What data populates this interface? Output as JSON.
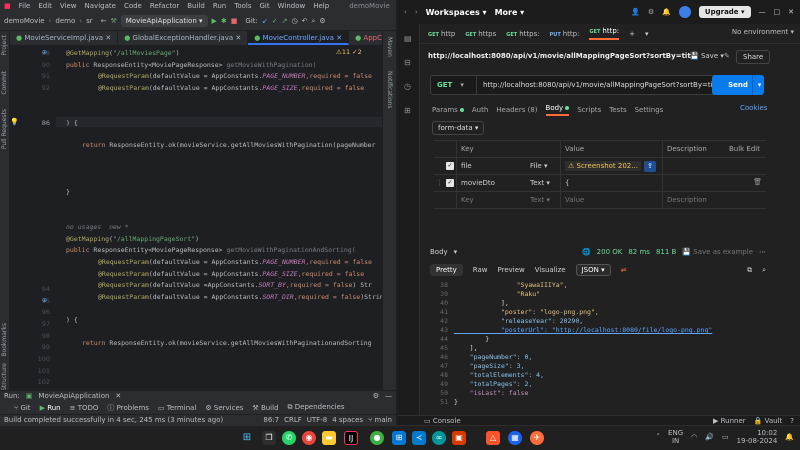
{
  "ide": {
    "menu": [
      "File",
      "Edit",
      "View",
      "Navigate",
      "Code",
      "Refactor",
      "Build",
      "Run",
      "Tools",
      "Git",
      "Window",
      "Help"
    ],
    "project_title": "demoMovie",
    "breadcrumb": [
      "demoMovie",
      "demo",
      "sr"
    ],
    "run_config": "MovieApiApplication",
    "git_label": "Git:",
    "tabs": [
      "MovieServiceImpl.java",
      "GlobalExceptionHandler.java",
      "MovieController.java",
      "AppConstants.java"
    ],
    "left_strip": [
      "Project",
      "Commit",
      "Pull Requests",
      "Bookmarks",
      "Structure"
    ],
    "right_strip": [
      "Maven",
      "Notifications"
    ],
    "inspection": "⚠11 ✓2",
    "hints": {
      "no_usages": "no usages",
      "new": "new *"
    },
    "code": {
      "l89_annotation": "@GetMapping",
      "l89_arg": "\"/allMoviesPage\"",
      "public": "public",
      "resp_entity_type": "ResponseEntity<MoviePageResponse>",
      "m1": "getMovieWithPagination(",
      "req_param": "@RequestParam",
      "default_value": "(defaultValue = ",
      "app_constants": "AppConstants.",
      "page_number": "PAGE_NUMBER",
      "page_size": "PAGE_SIZE",
      "sort_by": "SORT_BY",
      "sort_dir": "SORT_DIR",
      "required_false": ",required = false",
      "brace_open": ") {",
      "return": "return",
      "ret1": "ResponseEntity.ok(movieService.getAllMoviesWithPagination(pageNumber",
      "brace_close": "}",
      "l95_arg": "\"/allMappingPageSort\"",
      "m2": "getMovieWithPaginationAndSorting(",
      "sort_by_prefix": "(defaultValue =AppConstants.",
      "tail_str": ") Str",
      "tail_string": ")String",
      "ret2": "ResponseEntity.ok(movieService.getAllMoviesWithPaginationandSorting"
    },
    "line_numbers": [
      89,
      90,
      91,
      92,
      "",
      86,
      "",
      "",
      "",
      "",
      "",
      "",
      "",
      "",
      "",
      94,
      95,
      96,
      97,
      98,
      99,
      100,
      101,
      102,
      103,
      104
    ],
    "run_tab": "MovieApiApplication",
    "run_label": "Run:",
    "tool_windows": [
      "Git",
      "Run",
      "TODO",
      "Problems",
      "Terminal",
      "Services",
      "Build",
      "Dependencies"
    ],
    "status": {
      "message": "Build completed successfully in 4 sec, 245 ms (3 minutes ago)",
      "pos": "86:7",
      "crlf": "CRLF",
      "enc": "UTF-8",
      "indent": "4 spaces",
      "branch": "main"
    }
  },
  "postman": {
    "workspaces": "Workspaces",
    "more": "More",
    "upgrade": "Upgrade",
    "tabs": [
      {
        "method": "GET",
        "label": "http"
      },
      {
        "method": "GET",
        "label": "https"
      },
      {
        "method": "GET",
        "label": "https:"
      },
      {
        "method": "PUT",
        "label": "http:"
      },
      {
        "method": "GET",
        "label": "http:"
      }
    ],
    "environment": "No environment",
    "request_title": "http://localhost:8080/api/v1/movie/allMappingPageSort?sortBy=title&...",
    "save": "Save",
    "share": "Share",
    "method": "GET",
    "url": "http://localhost:8080/api/v1/movie/allMappingPageSort?sortBy=titlei...",
    "send": "Send",
    "req_tabs": [
      "Params",
      "Auth",
      "Headers (8)",
      "Body",
      "Scripts",
      "Tests",
      "Settings"
    ],
    "cookies": "Cookies",
    "body_type": "form-data",
    "table_headers": {
      "key": "Key",
      "value": "Value",
      "description": "Description",
      "bulk": "Bulk Edit"
    },
    "rows": [
      {
        "key": "file",
        "type": "File",
        "value": "⚠ Screenshot 202...",
        "desc": ""
      },
      {
        "key": "movieDto",
        "type": "Text",
        "value": "{",
        "desc": ""
      },
      {
        "key": "Key",
        "type": "Text",
        "value": "Value",
        "desc": "Description"
      }
    ],
    "response": {
      "label": "Body",
      "status": "200 OK",
      "time": "82 ms",
      "size": "811 B",
      "save_example": "Save as example"
    },
    "resp_tabs": [
      "Pretty",
      "Raw",
      "Preview",
      "Visualize"
    ],
    "format": "JSON",
    "json_lines": [
      {
        "n": "38",
        "t": "                \"SyawaIIIYa\","
      },
      {
        "n": "39",
        "t": "                \"Raku\""
      },
      {
        "n": "40",
        "t": "            ],"
      },
      {
        "n": "41",
        "t": "            \"poster\": \"logo-png.png\","
      },
      {
        "n": "42",
        "t": "            \"releaseYear\": 20290,"
      },
      {
        "n": "43",
        "t": "            \"posterUrl\": \"http://localhost:8080/file/logo-png.png\""
      },
      {
        "n": "44",
        "t": "        }"
      },
      {
        "n": "45",
        "t": "    ],"
      },
      {
        "n": "46",
        "t": "    \"pageNumber\": 0,"
      },
      {
        "n": "47",
        "t": "    \"pageSize\": 3,"
      },
      {
        "n": "48",
        "t": "    \"totalElements\": 4,"
      },
      {
        "n": "49",
        "t": "    \"totalPages\": 2,"
      },
      {
        "n": "50",
        "t": "    \"isLast\": false"
      },
      {
        "n": "51",
        "t": "}"
      }
    ],
    "status_bar": {
      "console": "Console",
      "runner": "Runner",
      "vault": "Vault"
    }
  },
  "taskbar": {
    "lang": "ENG",
    "region": "IN",
    "time": "10:02",
    "date": "19-08-2024"
  }
}
